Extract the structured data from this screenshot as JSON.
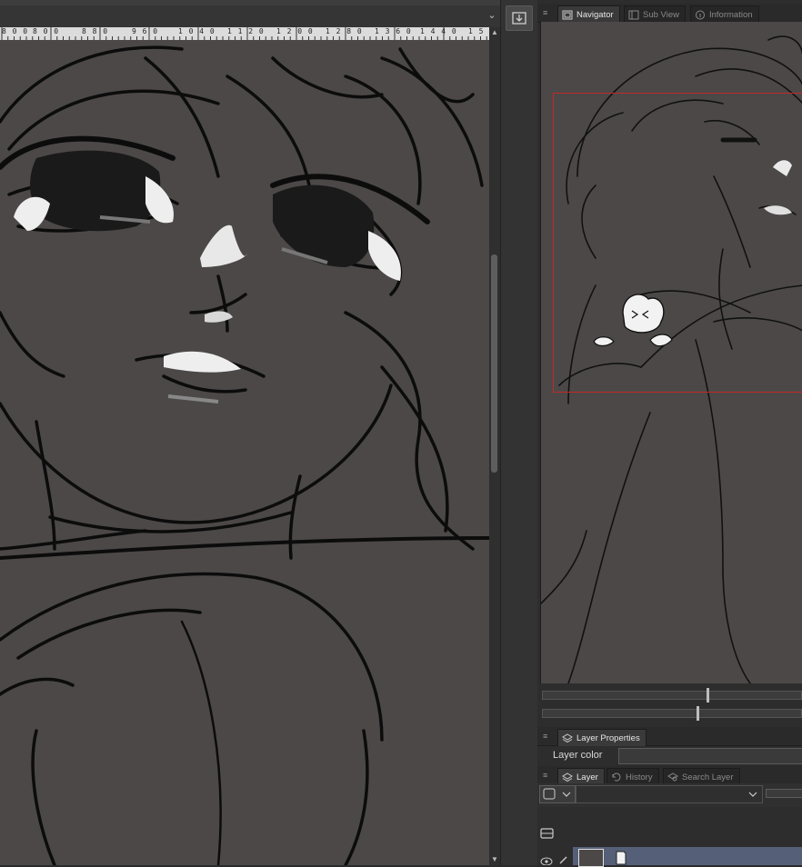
{
  "ruler": {
    "labels": [
      "8 0 0",
      "8 8 0",
      "9 6 0",
      "1 0 4 0",
      "1 1 2 0",
      "1 2 0 0",
      "1 2 8 0",
      "1 3 6 0",
      "1 4 4 0",
      "1 5"
    ]
  },
  "navigator": {
    "tabs": [
      {
        "label": "Navigator",
        "icon": "navigator-icon",
        "active": true
      },
      {
        "label": "Sub View",
        "icon": "sub-view-icon",
        "active": false
      },
      {
        "label": "Information",
        "icon": "info-icon",
        "active": false
      }
    ],
    "viewport_color": "#c02a2a"
  },
  "sliders": {
    "zoom": 0.63,
    "rotate": 0.59
  },
  "layer_properties": {
    "tab_label": "Layer Properties",
    "layer_color_label": "Layer color"
  },
  "layer_panel": {
    "tabs": [
      {
        "label": "Layer",
        "icon": "layer-icon",
        "active": true
      },
      {
        "label": "History",
        "icon": "history-icon",
        "active": false
      },
      {
        "label": "Search Layer",
        "icon": "search-layer-icon",
        "active": false
      }
    ]
  },
  "colors": {
    "canvas_bg": "#4c4848",
    "selected_layer": "#556078"
  }
}
